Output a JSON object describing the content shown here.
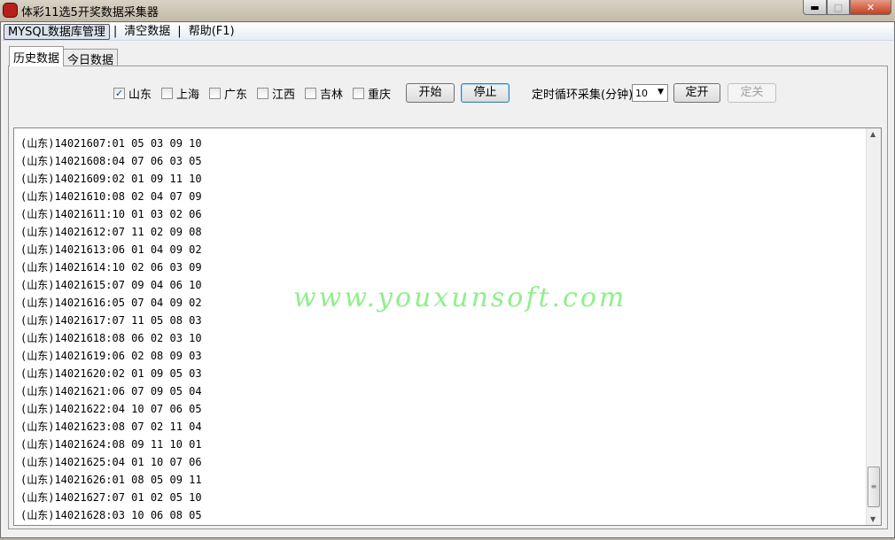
{
  "window": {
    "title": "体彩11选5开奖数据采集器",
    "controls": [
      "minimize",
      "maximize",
      "close"
    ]
  },
  "menu": [
    "MYSQL数据库管理",
    "清空数据",
    "帮助(F1)"
  ],
  "tabs": [
    {
      "label": "历史数据",
      "active": true
    },
    {
      "label": "今日数据",
      "active": false
    }
  ],
  "provinces": [
    {
      "label": "山东",
      "checked": true
    },
    {
      "label": "上海",
      "checked": false
    },
    {
      "label": "广东",
      "checked": false
    },
    {
      "label": "江西",
      "checked": false
    },
    {
      "label": "吉林",
      "checked": false
    },
    {
      "label": "重庆",
      "checked": false
    }
  ],
  "buttons": {
    "start": "开始",
    "stop": "停止",
    "timer_on": "定开",
    "timer_off": "定关"
  },
  "interval": {
    "label": "定时循环采集(分钟)",
    "value": "10"
  },
  "results": [
    "(山东)14021607:01 05 03 09 10",
    "(山东)14021608:04 07 06 03 05",
    "(山东)14021609:02 01 09 11 10",
    "(山东)14021610:08 02 04 07 09",
    "(山东)14021611:10 01 03 02 06",
    "(山东)14021612:07 11 02 09 08",
    "(山东)14021613:06 01 04 09 02",
    "(山东)14021614:10 02 06 03 09",
    "(山东)14021615:07 09 04 06 10",
    "(山东)14021616:05 07 04 09 02",
    "(山东)14021617:07 11 05 08 03",
    "(山东)14021618:08 06 02 03 10",
    "(山东)14021619:06 02 08 09 03",
    "(山东)14021620:02 01 09 05 03",
    "(山东)14021621:06 07 09 05 04",
    "(山东)14021622:04 10 07 06 05",
    "(山东)14021623:08 07 02 11 04",
    "(山东)14021624:08 09 11 10 01",
    "(山东)14021625:04 01 10 07 06",
    "(山东)14021626:01 08 05 09 11",
    "(山东)14021627:07 01 02 05 10",
    "(山东)14021628:03 10 06 08 05"
  ],
  "watermark": "www.youxunsoft.com"
}
